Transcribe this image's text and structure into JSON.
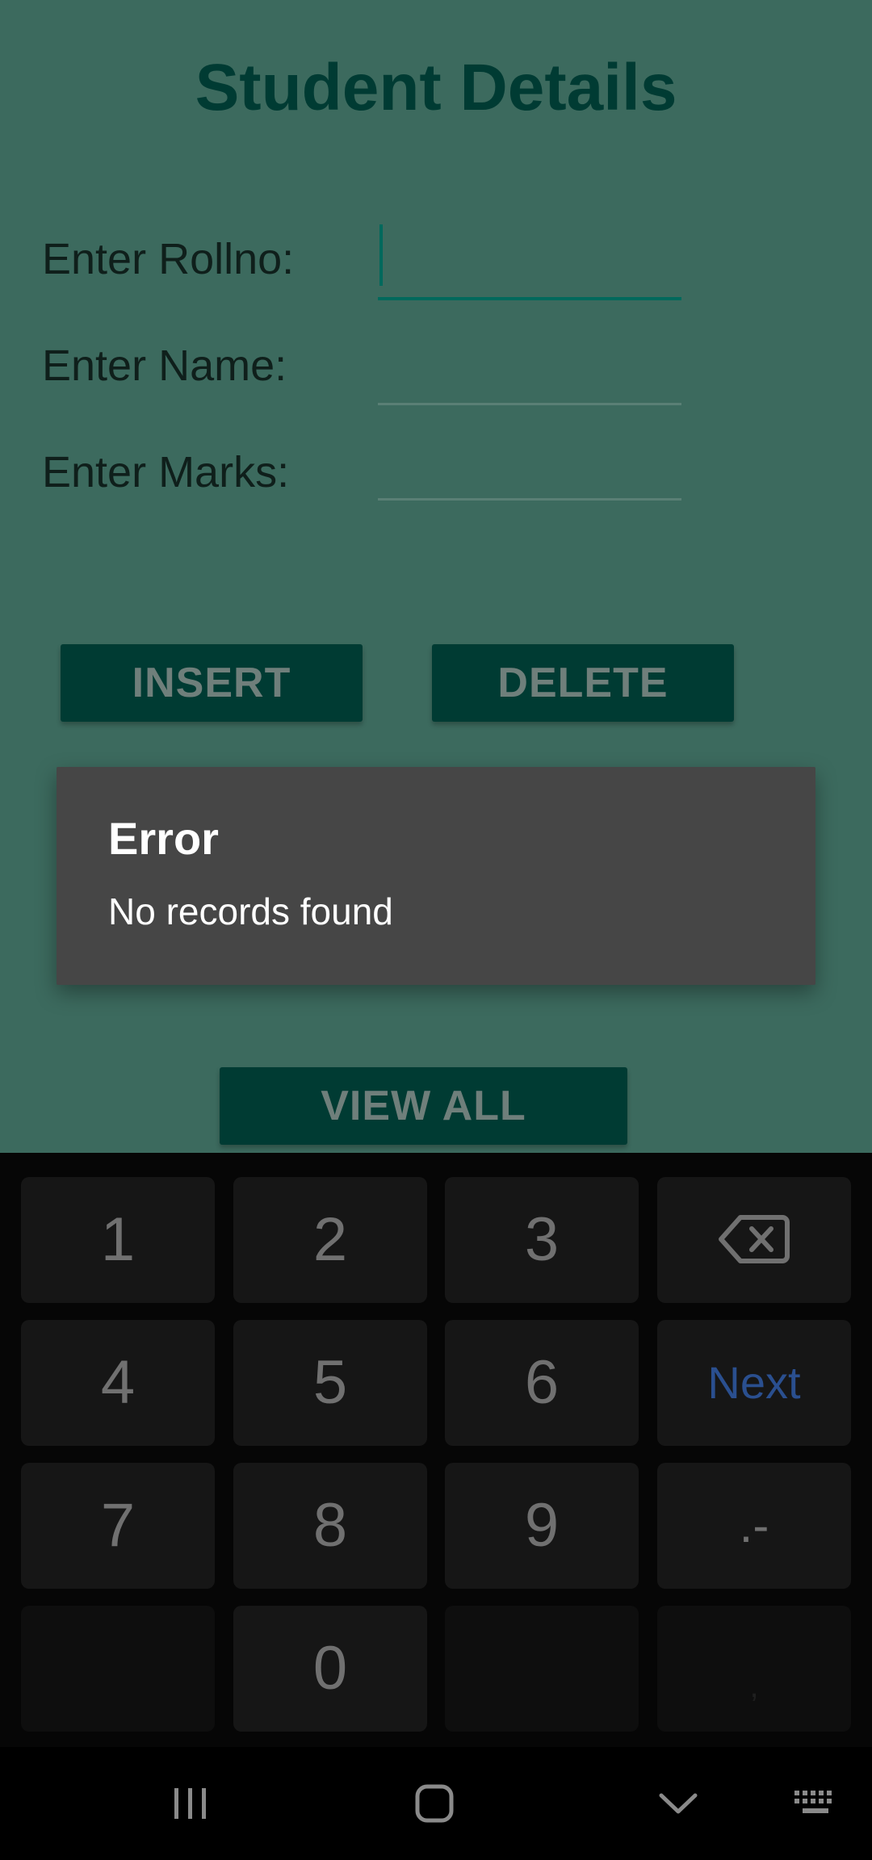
{
  "app": {
    "title": "Student Details",
    "fields": [
      {
        "label": "Enter Rollno:",
        "value": ""
      },
      {
        "label": "Enter Name:",
        "value": ""
      },
      {
        "label": "Enter Marks:",
        "value": ""
      }
    ],
    "buttons": {
      "insert": "INSERT",
      "delete": "DELETE",
      "view_all": "VIEW ALL"
    },
    "colors": {
      "background": "#3c6a5e",
      "primary_dark": "#003b33",
      "accent": "#00695c"
    }
  },
  "dialog": {
    "title": "Error",
    "message": "No records found"
  },
  "keyboard": {
    "rows": [
      [
        "1",
        "2",
        "3",
        "backspace-icon"
      ],
      [
        "4",
        "5",
        "6",
        "Next"
      ],
      [
        "7",
        "8",
        "9",
        ".-"
      ],
      [
        "",
        "0",
        "",
        ","
      ]
    ],
    "keys": {
      "k1": "1",
      "k2": "2",
      "k3": "3",
      "k4": "4",
      "k5": "5",
      "k6": "6",
      "k7": "7",
      "k8": "8",
      "k9": "9",
      "k0": "0",
      "next": "Next",
      "symbols": ".-",
      "comma": ","
    }
  },
  "navbar": {
    "icons": [
      "recent-apps-icon",
      "home-icon",
      "back-icon",
      "keyboard-icon"
    ]
  }
}
